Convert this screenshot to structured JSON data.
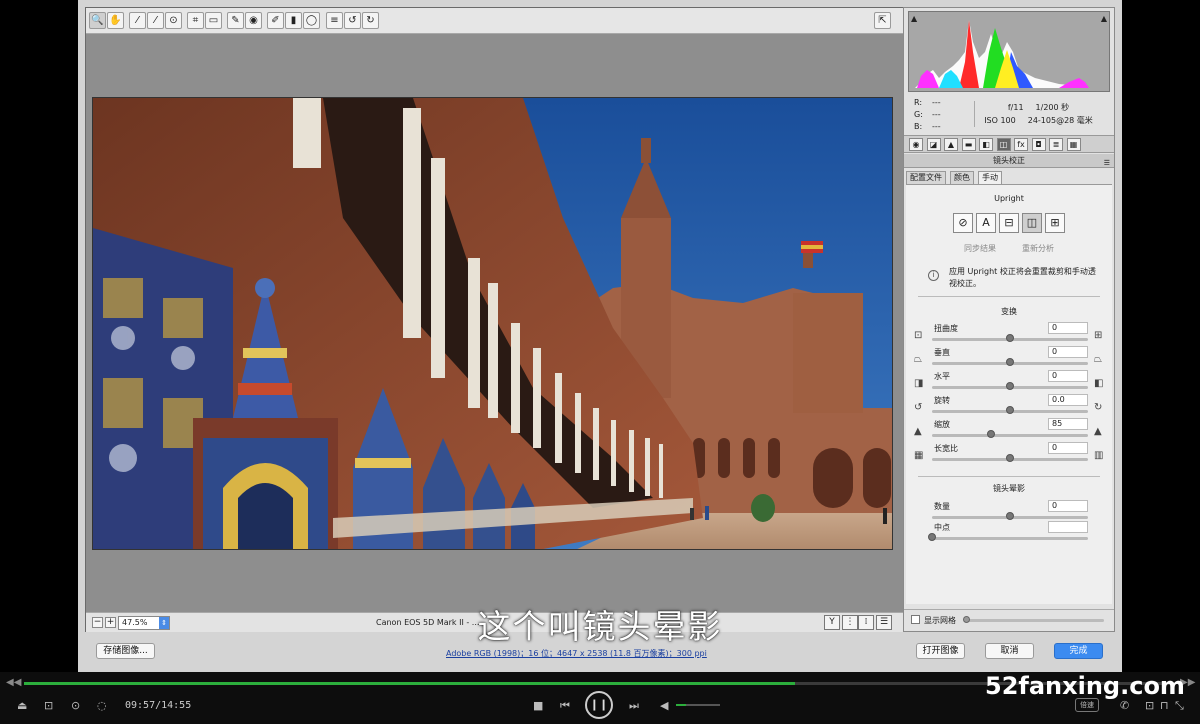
{
  "toolbar": {
    "tools": [
      {
        "name": "zoom-tool",
        "glyph": "🔍",
        "icon": "magnifier-icon"
      },
      {
        "name": "hand-tool",
        "glyph": "✋",
        "icon": "hand-icon"
      },
      {
        "name": "white-balance-tool",
        "glyph": "⁄",
        "icon": "eyedropper-icon"
      },
      {
        "name": "color-sampler-tool",
        "glyph": "⁄",
        "icon": "color-sampler-icon"
      },
      {
        "name": "targeted-adjustment-tool",
        "glyph": "⊙",
        "icon": "target-adjust-icon"
      },
      {
        "name": "crop-tool",
        "glyph": "⌗",
        "icon": "crop-icon"
      },
      {
        "name": "straighten-tool",
        "glyph": "▭",
        "icon": "straighten-icon"
      },
      {
        "name": "spot-removal-tool",
        "glyph": "✎",
        "icon": "spot-removal-icon"
      },
      {
        "name": "red-eye-tool",
        "glyph": "◉",
        "icon": "red-eye-icon"
      },
      {
        "name": "adjustment-brush-tool",
        "glyph": "✐",
        "icon": "brush-icon"
      },
      {
        "name": "graduated-filter-tool",
        "glyph": "▮",
        "icon": "graduated-filter-icon"
      },
      {
        "name": "radial-filter-tool",
        "glyph": "◯",
        "icon": "radial-filter-icon"
      },
      {
        "name": "preferences-tool",
        "glyph": "≡",
        "icon": "list-icon"
      },
      {
        "name": "rotate-left-tool",
        "glyph": "↺",
        "icon": "rotate-left-icon"
      },
      {
        "name": "rotate-right-tool",
        "glyph": "↻",
        "icon": "rotate-right-icon"
      }
    ],
    "fullscreen_glyph": "⇱"
  },
  "preview_footer": {
    "zoom_value": "47.5%",
    "camera": "Canon EOS 5D Mark II - ...",
    "view_buttons": [
      "Y",
      "⋮",
      "⁞",
      "☰"
    ]
  },
  "dialog_buttons": {
    "save": "存储图像...",
    "workflow": "Adobe RGB (1998)；16 位；4647 x 2538 (11.8 百万像素)；300 ppi",
    "open": "打开图像",
    "cancel": "取消",
    "done": "完成"
  },
  "readout": {
    "r_label": "R:",
    "r_value": "---",
    "g_label": "G:",
    "g_value": "---",
    "b_label": "B:",
    "b_value": "---",
    "aperture": "f/11",
    "shutter": "1/200 秒",
    "iso": "ISO 100",
    "lens": "24-105@28 毫米"
  },
  "panel": {
    "tab_glyphs": [
      "◉",
      "◪",
      "▲",
      "▬",
      "◧",
      "◫",
      "fx",
      "◘",
      "≣",
      "▦"
    ],
    "title": "镜头校正",
    "menu_glyph": "☰",
    "subtabs": [
      "配置文件",
      "颜色",
      "手动"
    ],
    "upright_title": "Upright",
    "upright_buttons": [
      "⊘",
      "A",
      "⊟",
      "◫",
      "⊞"
    ],
    "sync_label": "同步结果",
    "reanalyze_label": "重新分析",
    "info_icon": "i",
    "info_text": "应用 Upright 校正将会重置裁剪和手动透视校正。",
    "transform_title": "变换",
    "transform_sliders": [
      {
        "label": "扭曲度",
        "value": "0",
        "pos": 0.5,
        "licon": "⊡",
        "ricon": "⊞"
      },
      {
        "label": "垂直",
        "value": "0",
        "pos": 0.5,
        "licon": "⏢",
        "ricon": "⏢"
      },
      {
        "label": "水平",
        "value": "0",
        "pos": 0.5,
        "licon": "◨",
        "ricon": "◧"
      },
      {
        "label": "旋转",
        "value": "0.0",
        "pos": 0.5,
        "licon": "↺",
        "ricon": "↻"
      },
      {
        "label": "缩放",
        "value": "85",
        "pos": 0.38,
        "licon": "▲",
        "ricon": "▲"
      },
      {
        "label": "长宽比",
        "value": "0",
        "pos": 0.5,
        "licon": "▦",
        "ricon": "▥"
      }
    ],
    "vignette_title": "镜头晕影",
    "vignette_sliders": [
      {
        "label": "数量",
        "value": "0",
        "pos": 0.5
      },
      {
        "label": "中点",
        "value": "",
        "pos": 0.0
      }
    ],
    "grid_label": "显示网格"
  },
  "subtitle": "这个叫镜头晕影",
  "player": {
    "time": "09:57/14:55",
    "progress": 0.67,
    "volume": 0.22,
    "speed_label": "倍速",
    "watermark": "52fanxing.com",
    "play_glyph": "❙❙",
    "left_icons": [
      "⏏",
      "⊡",
      "⊙",
      "◌"
    ],
    "right_icons": [
      "✆",
      "⊡",
      "⊓",
      "⤡"
    ],
    "stop_glyph": "■",
    "prev_glyph": "⏮",
    "next_glyph": "⏭",
    "volume_glyph": "◀",
    "prog_left": "◀◀",
    "prog_right": "▶▶"
  },
  "colors": {
    "accent": "#3c8bf0",
    "progress": "#2cae3c"
  }
}
